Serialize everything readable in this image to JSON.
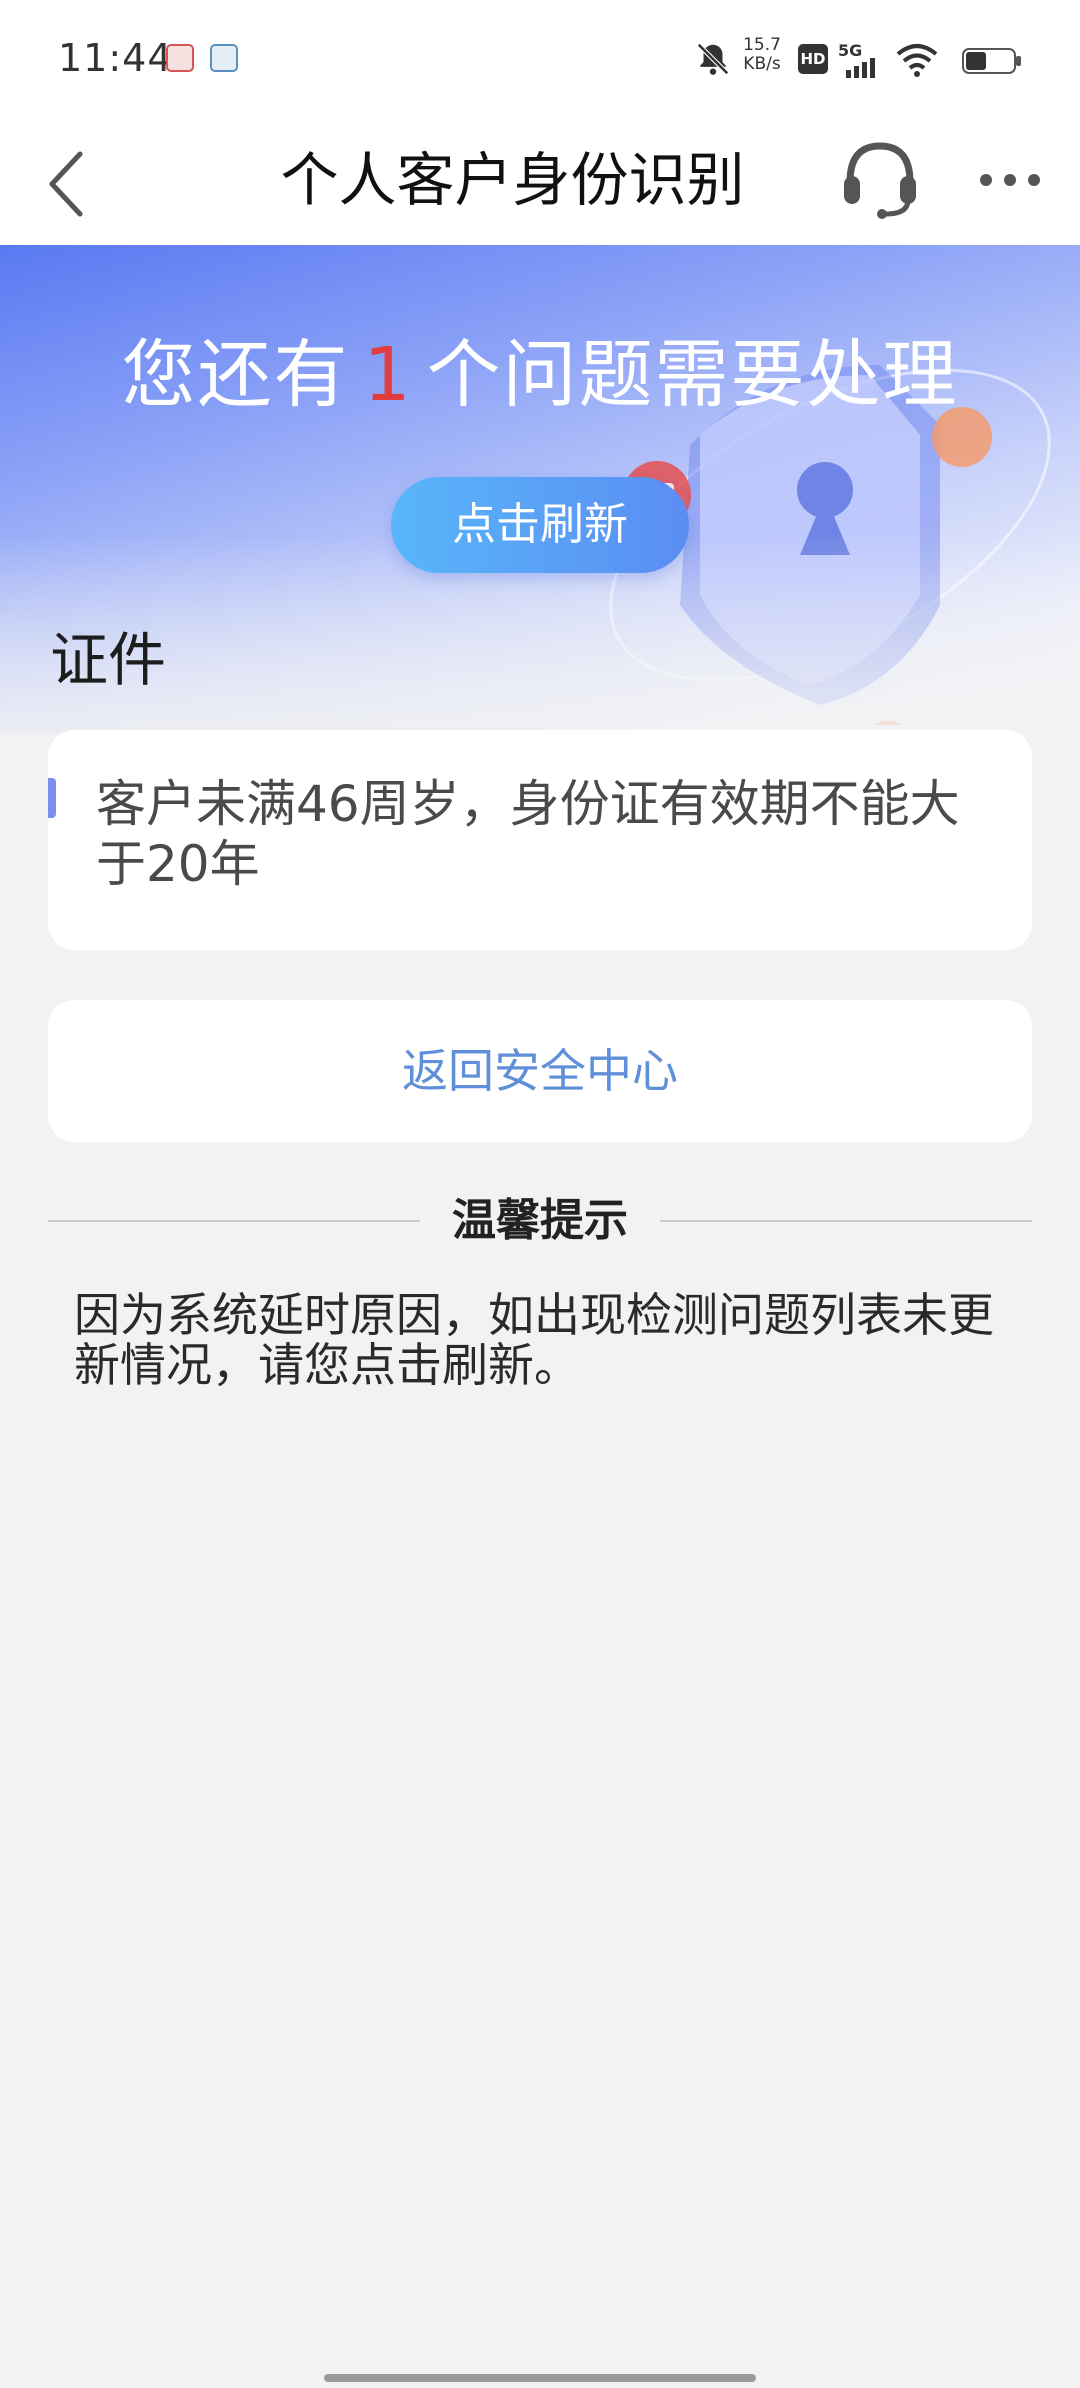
{
  "status_bar": {
    "time": "11:44",
    "net_speed_value": "15.7",
    "net_speed_unit": "KB/s",
    "hd_label": "HD",
    "network_label": "5G",
    "icons": [
      "notification-app-icon",
      "notification-app-icon",
      "bell-off-icon",
      "signal-icon",
      "wifi-icon",
      "battery-icon"
    ]
  },
  "nav": {
    "title": "个人客户身份识别",
    "icons": [
      "back-icon",
      "headset-icon",
      "more-icon"
    ]
  },
  "hero": {
    "title_prefix": "您还有",
    "issue_count": "1",
    "title_suffix": "个问题需要处理",
    "refresh_label": "点击刷新",
    "count_color": "#e23c3c"
  },
  "section": {
    "title": "证件"
  },
  "issue": {
    "text": "客户未满46周岁，身份证有效期不能大于20年"
  },
  "return_label": "返回安全中心",
  "tip": {
    "title": "温馨提示",
    "text": "因为系统延时原因，如出现检测问题列表未更新情况，请您点击刷新。"
  },
  "colors": {
    "accent": "#5f8fd8",
    "hero_blue": "#5a79f2",
    "refresh_gradient_start": "#58b6f9",
    "refresh_gradient_end": "#5b8df3"
  }
}
